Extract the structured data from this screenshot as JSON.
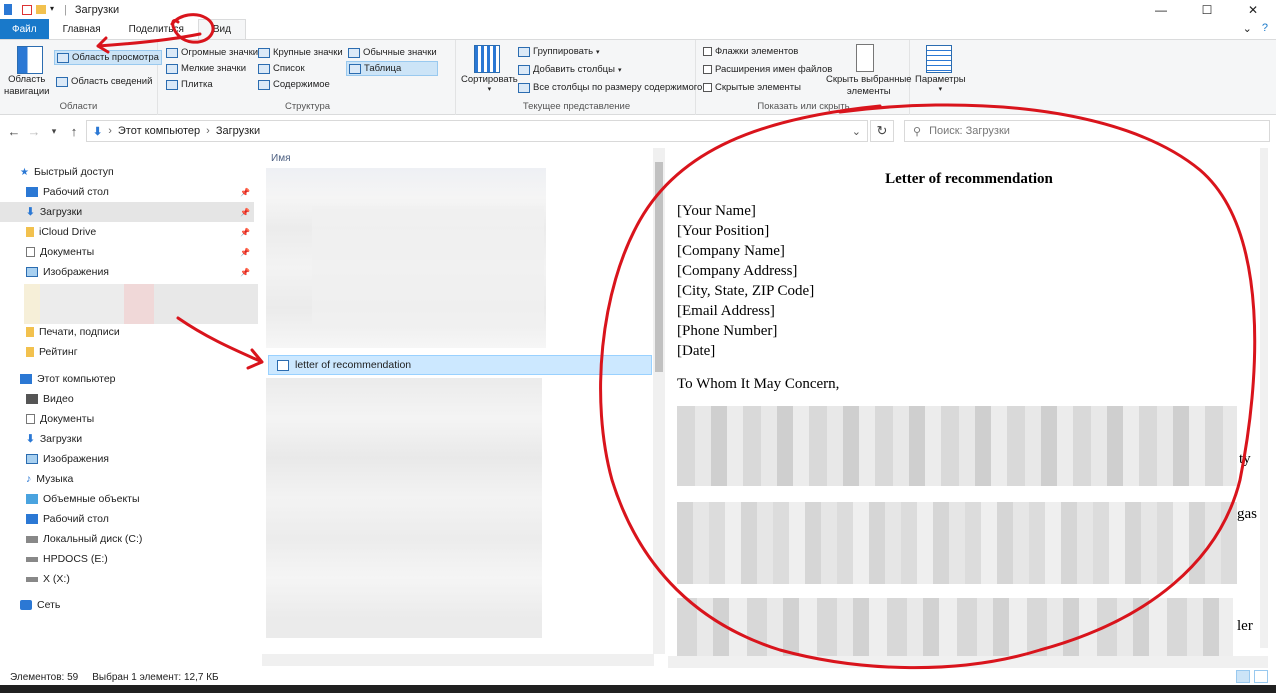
{
  "window": {
    "title": "Загрузки",
    "controls": {
      "minimize": "—",
      "maximize": "☐",
      "close": "✕"
    }
  },
  "ribbon_tabs": [
    {
      "label": "Файл"
    },
    {
      "label": "Главная"
    },
    {
      "label": "Поделиться"
    },
    {
      "label": "Вид"
    }
  ],
  "ribbon": {
    "panes": {
      "nav_pane": "Область навигации",
      "nav_pane_line1": "Область",
      "nav_pane_line2": "навигации",
      "preview_pane": "Область просмотра",
      "details_pane": "Область сведений",
      "label": "Области"
    },
    "layout": {
      "items": [
        "Огромные значки",
        "Крупные значки",
        "Обычные значки",
        "Мелкие значки",
        "Список",
        "Таблица",
        "Плитка",
        "Содержимое"
      ],
      "selected": "Таблица",
      "label": "Структура"
    },
    "current_view": {
      "sort": "Сортировать",
      "group": "Группировать",
      "add_columns": "Добавить столбцы",
      "fit_columns": "Все столбцы по размеру содержимого",
      "label": "Текущее представление"
    },
    "show_hide": {
      "item_checkboxes": "Флажки элементов",
      "file_extensions": "Расширения имен файлов",
      "hidden_items": "Скрытые элементы",
      "hide_selected_line1": "Скрыть выбранные",
      "hide_selected_line2": "элементы",
      "label": "Показать или скрыть"
    },
    "options": "Параметры"
  },
  "address": {
    "path": [
      "Этот компьютер",
      "Загрузки"
    ],
    "search_placeholder": "Поиск: Загрузки"
  },
  "nav": {
    "quick_access": "Быстрый доступ",
    "quick_items": [
      {
        "label": "Рабочий стол",
        "icon": "desktop-icon",
        "pinned": true
      },
      {
        "label": "Загрузки",
        "icon": "download-icon",
        "pinned": true,
        "selected": true
      },
      {
        "label": "iCloud Drive",
        "icon": "folder-icon",
        "pinned": true
      },
      {
        "label": "Документы",
        "icon": "documents-icon",
        "pinned": true
      },
      {
        "label": "Изображения",
        "icon": "pictures-icon",
        "pinned": true
      }
    ],
    "other_folders": [
      "Печати, подписи",
      "Рейтинг"
    ],
    "this_pc": "Этот компьютер",
    "pc_items": [
      {
        "label": "Видео",
        "icon": "video-icon"
      },
      {
        "label": "Документы",
        "icon": "documents-icon"
      },
      {
        "label": "Загрузки",
        "icon": "download-icon"
      },
      {
        "label": "Изображения",
        "icon": "pictures-icon"
      },
      {
        "label": "Музыка",
        "icon": "music-icon"
      },
      {
        "label": "Объемные объекты",
        "icon": "3d-objects-icon"
      },
      {
        "label": "Рабочий стол",
        "icon": "desktop-icon"
      },
      {
        "label": "Локальный диск (C:)",
        "icon": "drive-icon"
      },
      {
        "label": "HPDOCS (E:)",
        "icon": "drive-icon"
      },
      {
        "label": "X (X:)",
        "icon": "drive-icon"
      }
    ],
    "network": "Сеть"
  },
  "file_list": {
    "column": "Имя",
    "selected_file": "letter of recommendation"
  },
  "preview": {
    "title": "Letter of recommendation",
    "lines": [
      "[Your Name]",
      "[Your Position]",
      "[Company Name]",
      "[Company Address]",
      "[City, State, ZIP Code]",
      "[Email Address]",
      "[Phone Number]",
      "[Date]"
    ],
    "greeting": "To Whom It May Concern,",
    "fragments": [
      "ty",
      "gas",
      "ler"
    ]
  },
  "status": {
    "count": "Элементов: 59",
    "selected": "Выбран 1 элемент: 12,7 КБ"
  },
  "colors": {
    "accent": "#1979ca",
    "selection": "#cce8ff",
    "annotation": "#d9141c"
  }
}
